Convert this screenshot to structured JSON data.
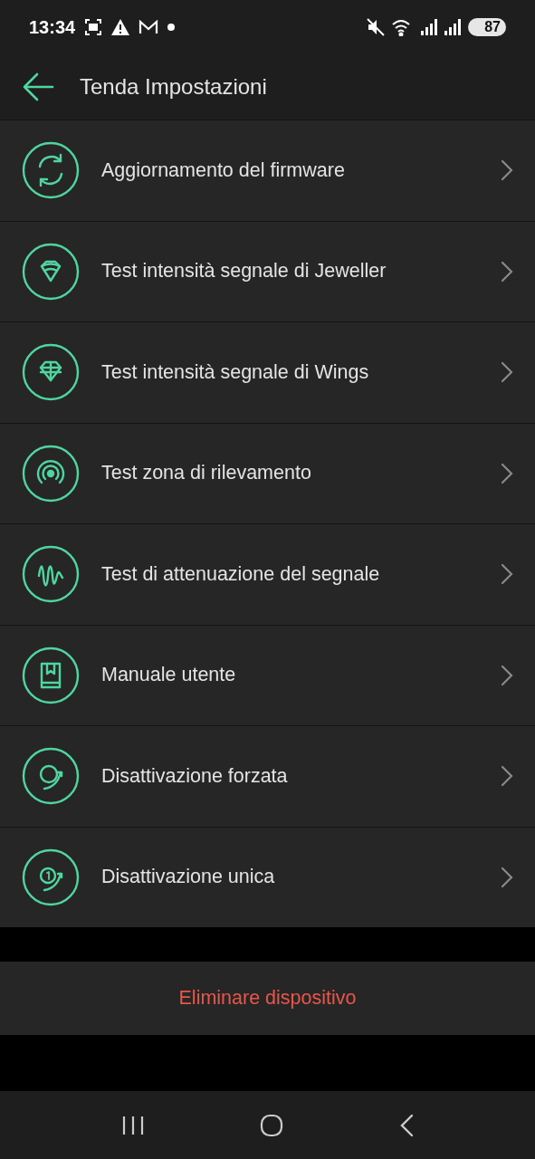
{
  "status_bar": {
    "time": "13:34",
    "battery": "87"
  },
  "header": {
    "title": "Tenda Impostazioni"
  },
  "items": [
    {
      "label": "Aggiornamento del firmware"
    },
    {
      "label": "Test intensità segnale di Jeweller"
    },
    {
      "label": "Test intensità segnale di Wings"
    },
    {
      "label": "Test zona di rilevamento"
    },
    {
      "label": "Test di attenuazione del segnale"
    },
    {
      "label": "Manuale utente"
    },
    {
      "label": "Disattivazione forzata"
    },
    {
      "label": "Disattivazione unica"
    }
  ],
  "delete_button": {
    "label": "Eliminare dispositivo"
  }
}
